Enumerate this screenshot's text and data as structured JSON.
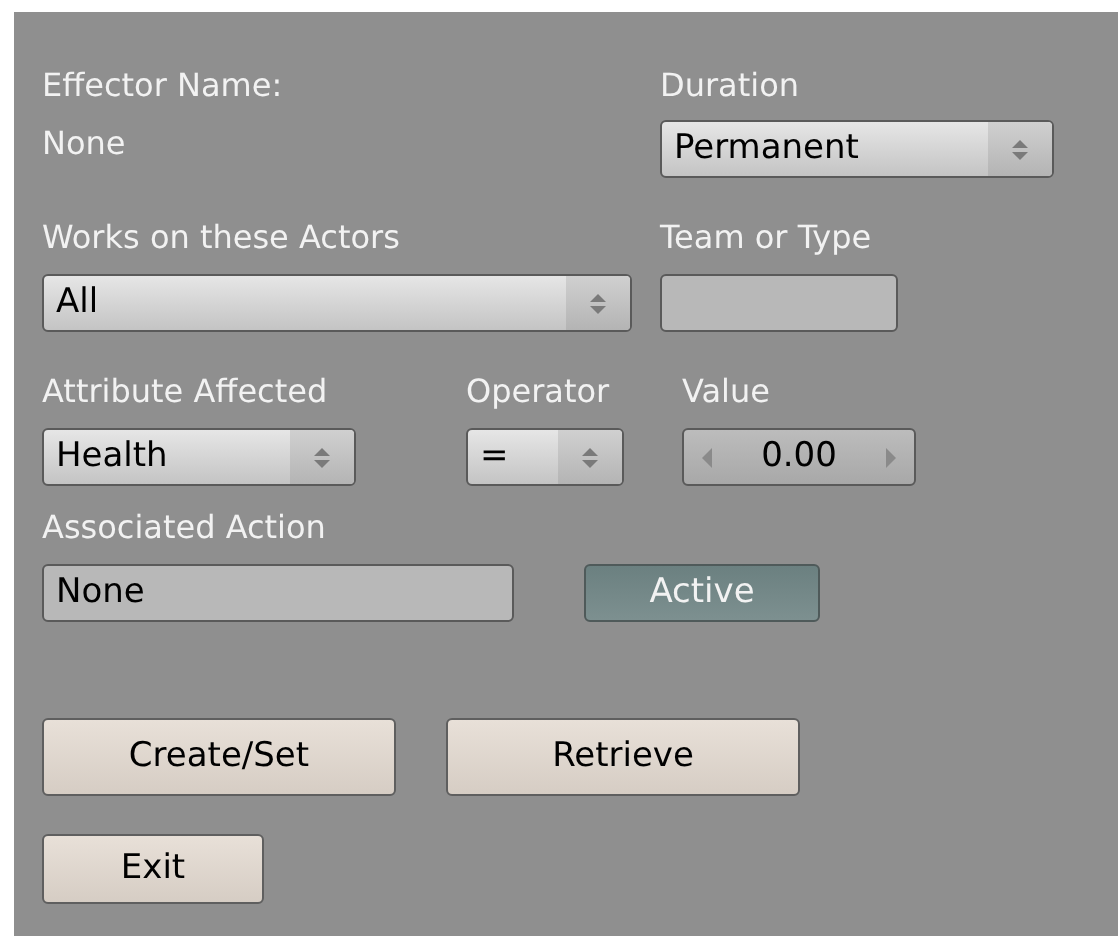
{
  "effector": {
    "label": "Effector Name:",
    "value": "None"
  },
  "duration": {
    "label": "Duration",
    "value": "Permanent"
  },
  "actors": {
    "label": "Works on these Actors",
    "value": "All"
  },
  "team_or_type": {
    "label": "Team or Type"
  },
  "attribute": {
    "label": "Attribute Affected",
    "value": "Health"
  },
  "operator": {
    "label": "Operator",
    "value": "="
  },
  "value": {
    "label": "Value",
    "value": "0.00"
  },
  "associated_action": {
    "label": "Associated Action",
    "value": "None"
  },
  "active_toggle": {
    "label": "Active",
    "on": true
  },
  "buttons": [
    {
      "label": "Create/Set"
    },
    {
      "label": "Retrieve"
    },
    {
      "label": "Exit"
    }
  ]
}
